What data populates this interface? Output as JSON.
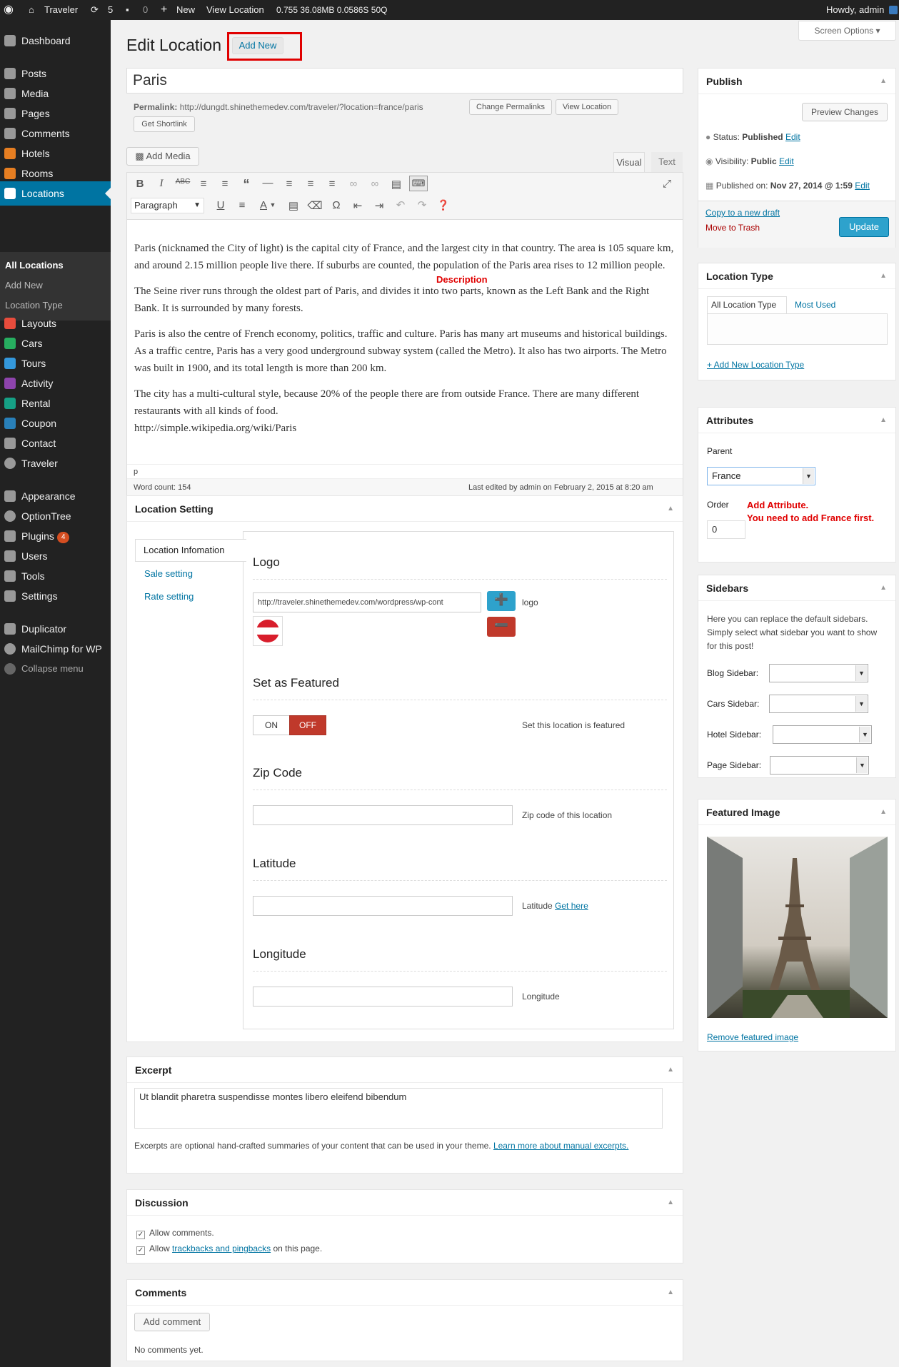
{
  "adminbar": {
    "site": "Traveler",
    "updates": "5",
    "comments": "0",
    "new": "New",
    "view": "View Location",
    "stats": "0.755  36.08MB  0.0586S  50Q",
    "howdy": "Howdy, admin"
  },
  "menu": {
    "items": [
      "Dashboard",
      "Posts",
      "Media",
      "Pages",
      "Comments",
      "Hotels",
      "Rooms",
      "Locations",
      "Layouts",
      "Cars",
      "Tours",
      "Activity",
      "Rental",
      "Coupon",
      "Contact",
      "Traveler",
      "Appearance",
      "OptionTree",
      "Plugins",
      "Users",
      "Tools",
      "Settings",
      "Duplicator",
      "MailChimp for WP",
      "Collapse menu"
    ],
    "plugins_badge": "4",
    "sub": [
      "All Locations",
      "Add New",
      "Location Type"
    ]
  },
  "page": {
    "title": "Edit Location",
    "add_new": "Add New",
    "screen_options": "Screen Options",
    "post_title": "Paris",
    "permalink_label": "Permalink:",
    "permalink_url": "http://dungdt.shinethemedev.com/traveler/?location=france/paris",
    "change_permalinks": "Change Permalinks",
    "view_location": "View Location",
    "get_shortlink": "Get Shortlink"
  },
  "editor": {
    "add_media": "Add Media",
    "tab_visual": "Visual",
    "tab_text": "Text",
    "format": "Paragraph",
    "paragraphs": [
      "Paris (nicknamed the City of light) is the capital city of France, and the largest city in that country. The area is 105 square km, and around 2.15 million people live there. If suburbs are counted, the population of the Paris area rises to 12 million people.",
      "The Seine river runs through the oldest part of Paris, and divides it into two parts, known as the Left Bank and the Right Bank. It is surrounded by many forests.",
      "Paris is also the centre of French economy, politics, traffic and culture. Paris has many art museums and historical buildings. As a traffic centre, Paris has a very good underground subway system (called the Metro). It also has two airports. The Metro was built in 1900, and its total length is more than 200 km.",
      "The city has a multi-cultural style, because 20% of the people there are from outside France. There are many different restaurants with all kinds of food."
    ],
    "source_link": "http://simple.wikipedia.org/wiki/Paris",
    "description_annotation": "Description",
    "path": "p",
    "word_count": "Word count: 154",
    "last_edited": "Last edited by admin on February 2, 2015 at 8:20 am"
  },
  "location_setting": {
    "title": "Location Setting",
    "tabs": [
      "Location Infomation",
      "Sale setting",
      "Rate setting"
    ],
    "logo_title": "Logo",
    "logo_url": "http://traveler.shinethemedev.com/wordpress/wp-cont",
    "logo_help": "logo",
    "featured_title": "Set as Featured",
    "on": "ON",
    "off": "OFF",
    "featured_help": "Set this location is featured",
    "zip_title": "Zip Code",
    "zip_help": "Zip code of this location",
    "lat_title": "Latitude",
    "lat_help": "Latitude",
    "lat_link": "Get here",
    "lng_title": "Longitude",
    "lng_help": "Longitude"
  },
  "excerpt": {
    "title": "Excerpt",
    "text": "Ut blandit pharetra suspendisse montes libero eleifend bibendum",
    "note": "Excerpts are optional hand-crafted summaries of your content that can be used in your theme.",
    "note_link": "Learn more about manual excerpts."
  },
  "discussion": {
    "title": "Discussion",
    "allow_comments": "Allow comments.",
    "allow_pre": "Allow",
    "allow_link": "trackbacks and pingbacks",
    "allow_post": "on this page."
  },
  "comments": {
    "title": "Comments",
    "add": "Add comment",
    "none": "No comments yet."
  },
  "publish": {
    "title": "Publish",
    "preview": "Preview Changes",
    "status_label": "Status:",
    "status": "Published",
    "visibility_label": "Visibility:",
    "visibility": "Public",
    "published_label": "Published on:",
    "published": "Nov 27, 2014 @ 1:59",
    "edit": "Edit",
    "copy": "Copy to a new draft",
    "trash": "Move to Trash",
    "update": "Update"
  },
  "location_type": {
    "title": "Location Type",
    "tab_all": "All Location Type",
    "tab_used": "Most Used",
    "add": "+ Add New Location Type"
  },
  "attributes": {
    "title": "Attributes",
    "parent_label": "Parent",
    "parent": "France",
    "order_label": "Order",
    "order": "0",
    "annotation1": "Add Attribute.",
    "annotation2": "You need to add France first."
  },
  "sidebars": {
    "title": "Sidebars",
    "desc": "Here you can replace the default sidebars. Simply select what sidebar you want to show for this post!",
    "labels": [
      "Blog Sidebar:",
      "Cars Sidebar:",
      "Hotel Sidebar:",
      "Page Sidebar:"
    ]
  },
  "featured_image": {
    "title": "Featured Image",
    "remove": "Remove featured image"
  },
  "colors": {
    "accent": "#0074a2",
    "annotation": "#e00000",
    "adminbar": "#222222",
    "update": "#2ea2cc",
    "off": "#c0392b"
  }
}
